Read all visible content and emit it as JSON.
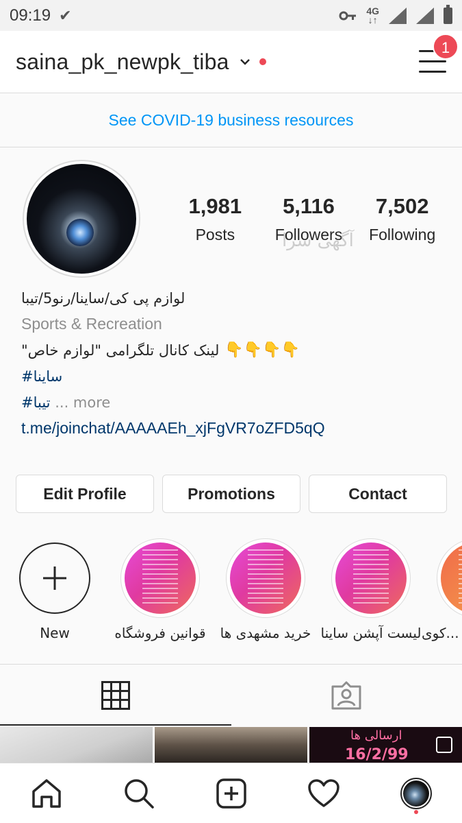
{
  "status_bar": {
    "time": "09:19",
    "network": "4G"
  },
  "header": {
    "username": "saina_pk_newpk_tiba",
    "notification_count": "1"
  },
  "covid_banner": {
    "text": "See COVID-19 business resources"
  },
  "stats": [
    {
      "value": "1,981",
      "label": "Posts"
    },
    {
      "value": "5,116",
      "label": "Followers"
    },
    {
      "value": "7,502",
      "label": "Following"
    }
  ],
  "watermark": "آگهی سرا",
  "bio": {
    "name": "لوازم پی کی/ساینا/رنو5/تیبا",
    "category": "Sports & Recreation",
    "line": "\"لینک کانال تلگرامی \"لوازم خاص",
    "emojis": "👇👇👇👇",
    "hashtag1": "#ساینا",
    "hashtag2": "#تیبا",
    "more": "... more",
    "link": "t.me/joinchat/AAAAAEh_xjFgVR7oZFD5qQ"
  },
  "buttons": {
    "edit": "Edit Profile",
    "promotions": "Promotions",
    "contact": "Contact"
  },
  "highlights": [
    {
      "label": "New"
    },
    {
      "label": "قوانین فروشگاه"
    },
    {
      "label": "خرید مشهدی ها"
    },
    {
      "label": "لیست آپشن ساینا"
    },
    {
      "label": "کوی..."
    }
  ],
  "grid": {
    "post3_line1": "ارسالی ها",
    "post3_line2": "16/2/99"
  },
  "colors": {
    "accent": "#0095f6",
    "badge": "#ed4956",
    "link": "#00376b"
  }
}
